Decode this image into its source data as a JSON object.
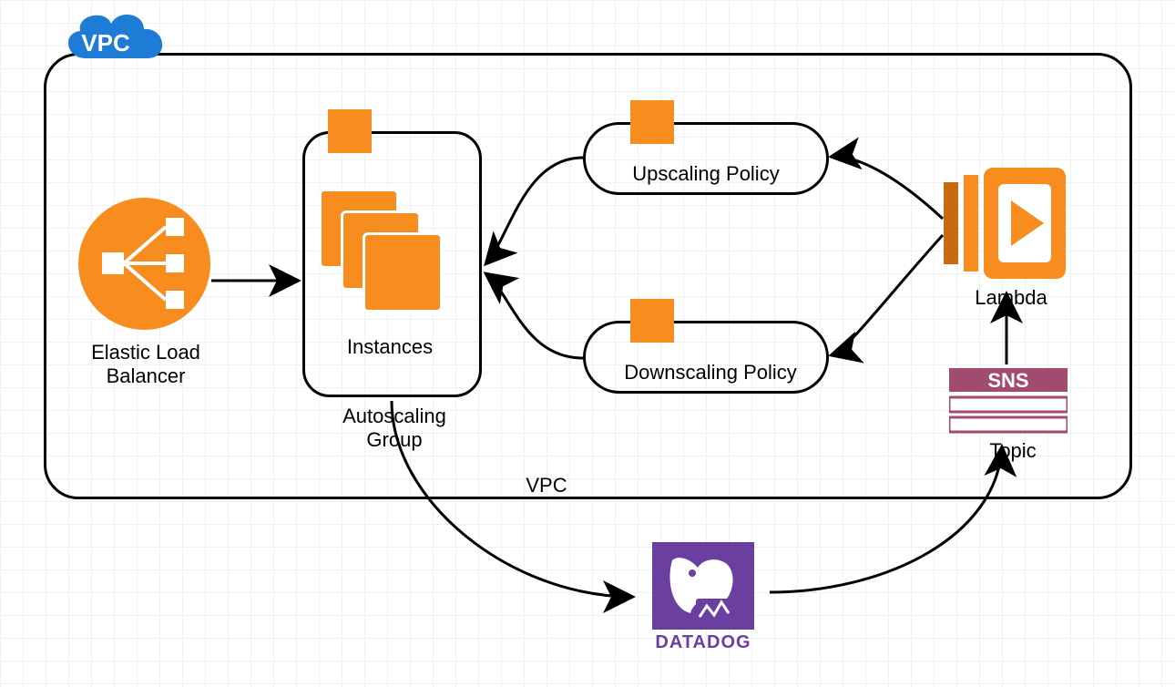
{
  "vpc": {
    "cloud_label": "VPC",
    "bottom_label": "VPC"
  },
  "elb": {
    "label": "Elastic Load\nBalancer"
  },
  "asg": {
    "label": "Autoscaling\nGroup",
    "instances_label": "Instances"
  },
  "upscale": {
    "label": "Upscaling Policy"
  },
  "downscale": {
    "label": "Downscaling Policy"
  },
  "lambda": {
    "label": "Lambda"
  },
  "sns": {
    "label": "Topic",
    "badge": "SNS"
  },
  "datadog": {
    "label": "DATADOG"
  }
}
